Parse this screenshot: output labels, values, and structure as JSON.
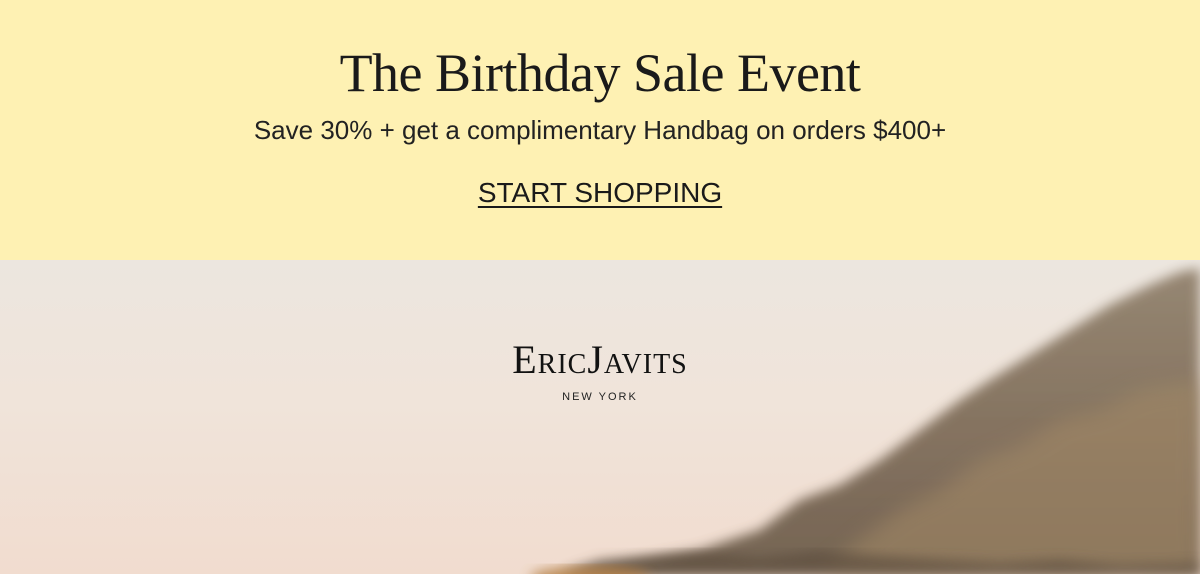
{
  "banner": {
    "title": "The Birthday Sale Event",
    "subtitle": "Save 30% + get a complimentary Handbag on orders $400+",
    "cta_label": "START SHOPPING",
    "background_color": "#fef1b3"
  },
  "hero": {
    "logo": {
      "wordmark": "EricJavits",
      "location": "NEW YORK"
    }
  }
}
